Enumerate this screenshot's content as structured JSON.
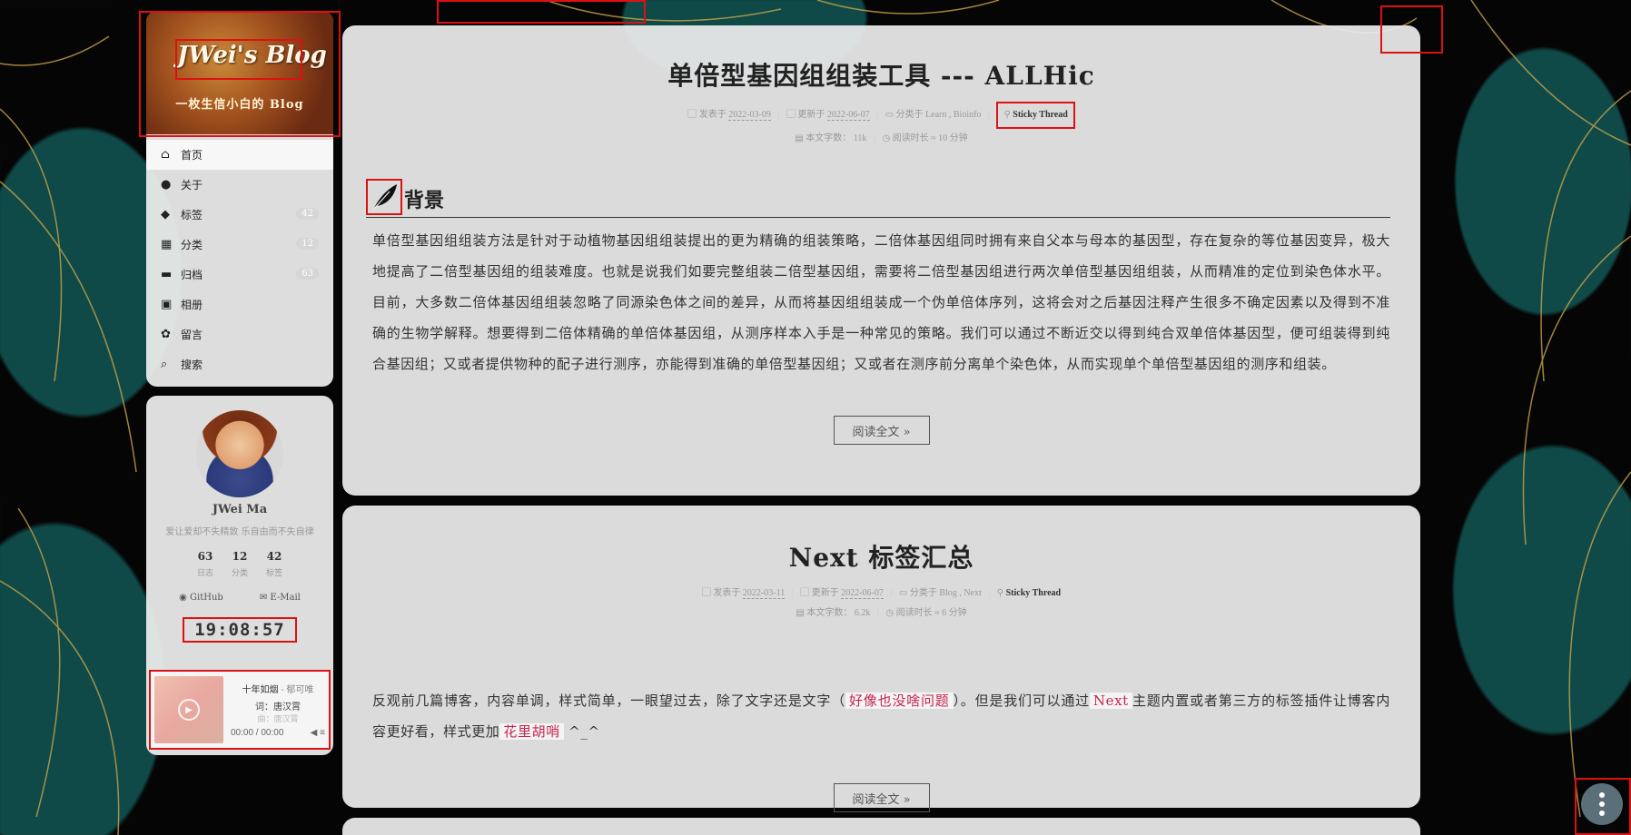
{
  "brand": {
    "title": "JWei's Blog",
    "subtitle": "一枚生信小白的 Blog"
  },
  "menu": [
    {
      "icon": "home-icon",
      "glyph": "⌂",
      "label": "首页"
    },
    {
      "icon": "user-icon",
      "glyph": "●",
      "label": "关于"
    },
    {
      "icon": "tags-icon",
      "glyph": "◆",
      "label": "标签",
      "badge": "42"
    },
    {
      "icon": "grid-icon",
      "glyph": "▦",
      "label": "分类",
      "badge": "12"
    },
    {
      "icon": "archive-icon",
      "glyph": "▬",
      "label": "归档",
      "badge": "63"
    },
    {
      "icon": "image-icon",
      "glyph": "▣",
      "label": "相册"
    },
    {
      "icon": "lotus-icon",
      "glyph": "✿",
      "label": "留言"
    },
    {
      "icon": "search-icon",
      "glyph": "⌕",
      "label": "搜索"
    }
  ],
  "author": {
    "name": "JWei Ma",
    "description": "爱让爱却不失精致 乐自由而不失自律",
    "stats": [
      {
        "value": "63",
        "label": "日志"
      },
      {
        "value": "12",
        "label": "分类"
      },
      {
        "value": "42",
        "label": "标签"
      }
    ],
    "links": [
      {
        "icon": "github-icon",
        "glyph": "◉",
        "label": "GitHub"
      },
      {
        "icon": "email-icon",
        "glyph": "✉",
        "label": "E-Mail"
      }
    ]
  },
  "clock": "19:08:57",
  "player": {
    "song": "十年如烟",
    "artist": " - 郁可唯",
    "lyric1": "词：唐汉霄",
    "lyric2": "曲：唐汉霄",
    "time": "00:00 / 00:00",
    "play_glyph": "▶",
    "volume_glyph": "◀",
    "list_glyph": "≡"
  },
  "posts": [
    {
      "title": "单倍型基因组组装工具 --- ALLHic",
      "posted_label": "发表于",
      "posted": "2022-03-09",
      "updated_label": "更新于",
      "updated": "2022-06-07",
      "category_label": "分类于",
      "categories": [
        "Learn",
        "Bioinfo"
      ],
      "sticky": "Sticky Thread",
      "words_label": "本文字数：",
      "words": "11k",
      "read_label": "阅读时长 ≈",
      "read": "10 分钟",
      "section": "背景",
      "body": "单倍型基因组组装方法是针对于动植物基因组组装提出的更为精确的组装策略，二倍体基因组同时拥有来自父本与母本的基因型，存在复杂的等位基因变异，极大地提高了二倍型基因组的组装难度。也就是说我们如要完整组装二倍型基因组，需要将二倍型基因组进行两次单倍型基因组组装，从而精准的定位到染色体水平。目前，大多数二倍体基因组组装忽略了同源染色体之间的差异，从而将基因组组装成一个伪单倍体序列，这将会对之后基因注释产生很多不确定因素以及得到不准确的生物学解释。想要得到二倍体精确的单倍体基因组，从测序样本入手是一种常见的策略。我们可以通过不断近交以得到纯合双单倍体基因型，便可组装得到纯合基因组；又或者提供物种的配子进行测序，亦能得到准确的单倍型基因组；又或者在测序前分离单个染色体，从而实现单个单倍型基因组的测序和组装。",
      "more": "阅读全文 »"
    },
    {
      "title": "Next 标签汇总",
      "posted_label": "发表于",
      "posted": "2022-03-11",
      "updated_label": "更新于",
      "updated": "2022-06-07",
      "category_label": "分类于",
      "categories": [
        "Blog",
        "Next"
      ],
      "sticky": "Sticky Thread",
      "words_label": "本文字数：",
      "words": "6.2k",
      "read_label": "阅读时长 ≈",
      "read": "6 分钟",
      "body_a": "反观前几篇博客，内容单调，样式简单，一眼望过去，除了文字还是文字（",
      "body_hl1": "好像也没啥问题",
      "body_b": "）。但是我们可以通过",
      "body_hl2": "Next",
      "body_c": "主题内置或者第三方的标签插件让博客内容更好看，样式更加",
      "body_hl3": "花里胡哨",
      "body_d": " ^_^",
      "more": "阅读全文 »"
    }
  ],
  "colors": {
    "accent": "#d11111",
    "highlight": "#c7254e",
    "leaf": "#0f4a48"
  }
}
